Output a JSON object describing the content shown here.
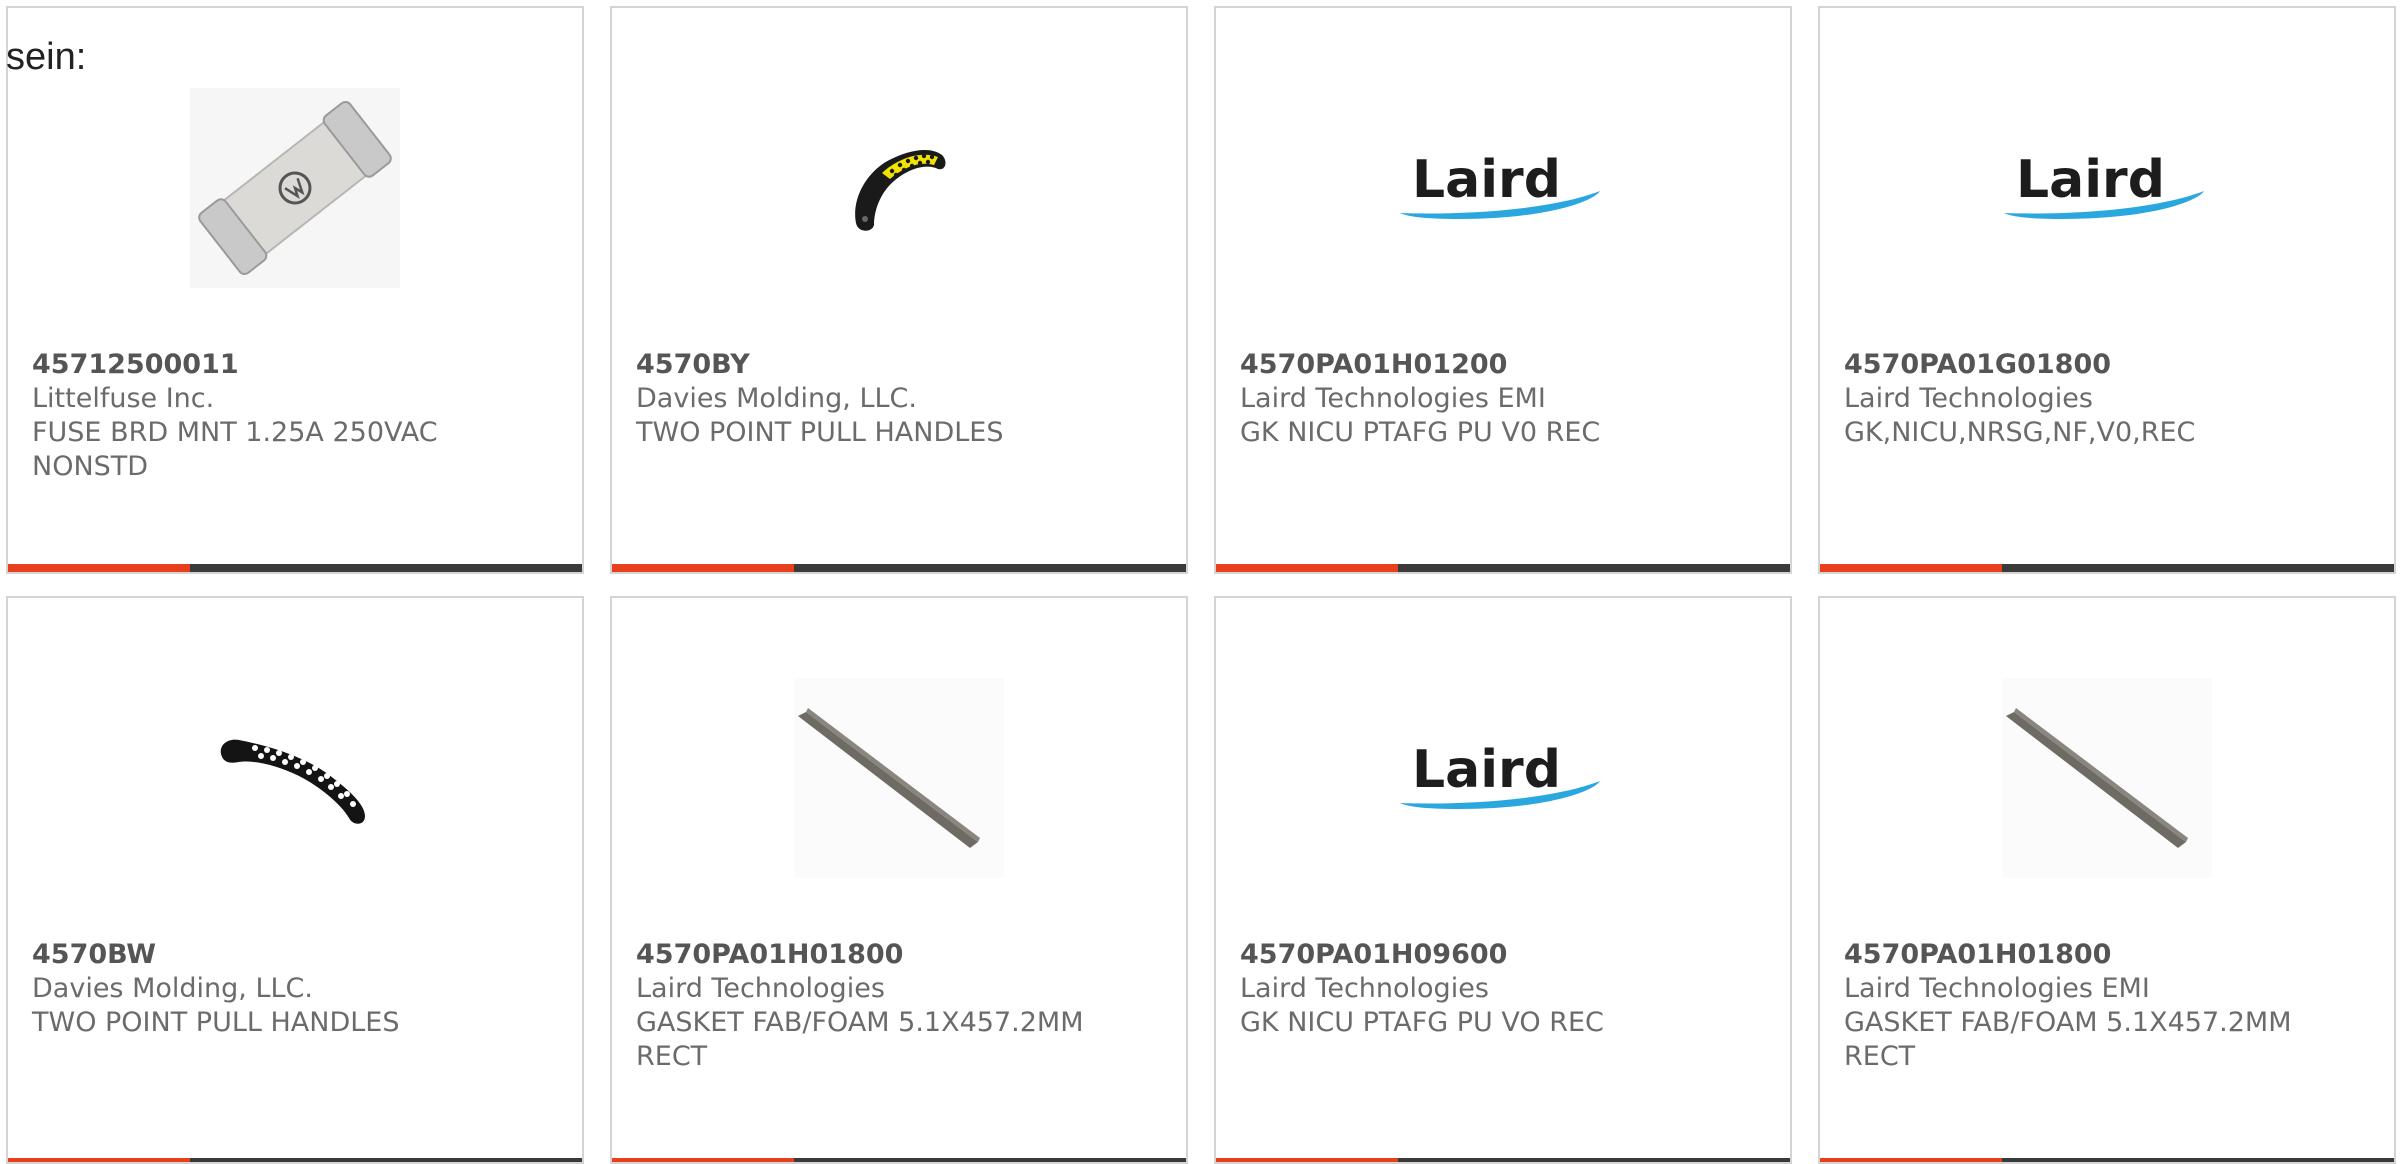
{
  "lead_text": "sein:",
  "colors": {
    "accent": "#e8401c",
    "bar": "#3a3a3a",
    "border": "#d4d4d4",
    "text": "#6b6b6b",
    "laird_blue": "#2aa7df"
  },
  "products": [
    {
      "part_number": "45712500011",
      "manufacturer": "Littelfuse Inc.",
      "description": "FUSE BRD MNT 1.25A 250VAC NONSTD",
      "image": "fuse-image"
    },
    {
      "part_number": "4570BY",
      "manufacturer": "Davies Molding, LLC.",
      "description": "TWO POINT PULL HANDLES",
      "image": "yellow-pull-handle-image"
    },
    {
      "part_number": "4570PA01H01200",
      "manufacturer": "Laird Technologies EMI",
      "description": "GK NICU PTAFG PU V0 REC",
      "image": "laird-logo",
      "logo_text": "Laird"
    },
    {
      "part_number": "4570PA01G01800",
      "manufacturer": "Laird Technologies",
      "description": "GK,NICU,NRSG,NF,V0,REC",
      "image": "laird-logo",
      "logo_text": "Laird"
    },
    {
      "part_number": "4570BW",
      "manufacturer": "Davies Molding, LLC.",
      "description": "TWO POINT PULL HANDLES",
      "image": "white-dotted-pull-handle-image"
    },
    {
      "part_number": "4570PA01H01800",
      "manufacturer": "Laird Technologies",
      "description": "GASKET FAB/FOAM 5.1X457.2MM RECT",
      "image": "gasket-strip-image"
    },
    {
      "part_number": "4570PA01H09600",
      "manufacturer": "Laird Technologies",
      "description": "GK NICU PTAFG PU VO REC",
      "image": "laird-logo",
      "logo_text": "Laird"
    },
    {
      "part_number": "4570PA01H01800",
      "manufacturer": "Laird Technologies EMI",
      "description": "GASKET FAB/FOAM 5.1X457.2MM RECT",
      "image": "gasket-strip-image"
    }
  ]
}
